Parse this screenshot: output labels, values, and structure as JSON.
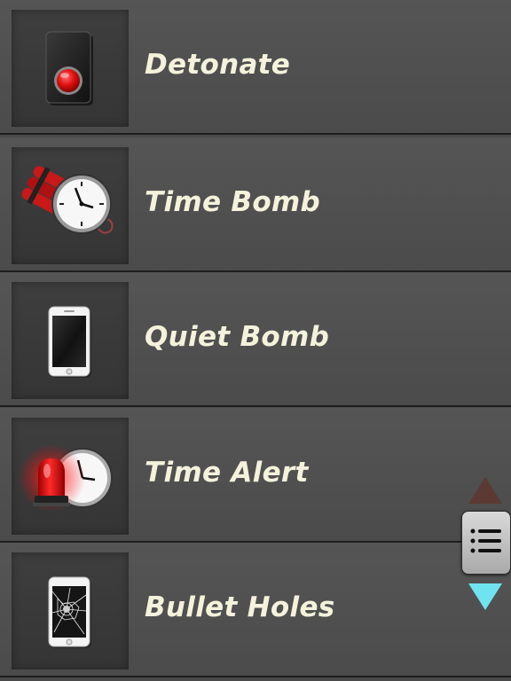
{
  "modes": [
    {
      "label": "Detonate",
      "icon": "detonator-button-icon"
    },
    {
      "label": "Time Bomb",
      "icon": "dynamite-clock-icon"
    },
    {
      "label": "Quiet Bomb",
      "icon": "phone-icon"
    },
    {
      "label": "Time Alert",
      "icon": "siren-clock-icon"
    },
    {
      "label": "Bullet Holes",
      "icon": "cracked-phone-icon"
    }
  ],
  "colors": {
    "label_text": "#f5f2dc",
    "up_arrow": "#5a3a32",
    "down_arrow": "#6fe3ef",
    "background": "#4a4a4a"
  }
}
